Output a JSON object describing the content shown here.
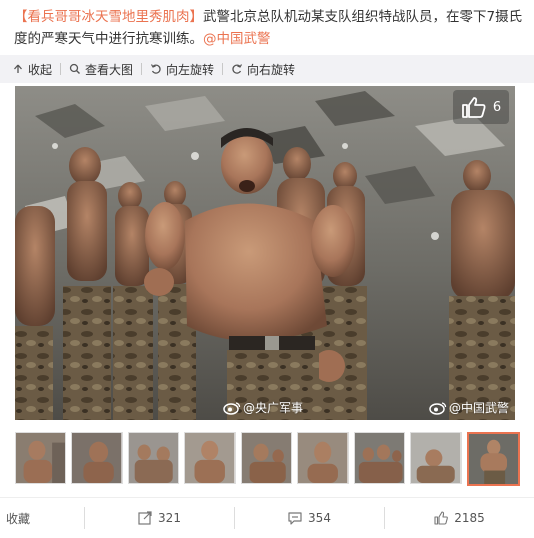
{
  "post": {
    "tag": "【看兵哥哥冰天雪地里秀肌肉】",
    "body": "武警北京总队机动某支队组织特战队员，在零下7摄氏度的严寒天气中进行抗寒训练。",
    "mention": "@中国武警"
  },
  "toolbar": {
    "collapse": "收起",
    "view_large": "查看大图",
    "rotate_left": "向左旋转",
    "rotate_right": "向右旋转",
    "icons": [
      "collapse-arrow-icon",
      "magnifier-icon",
      "rotate-left-icon",
      "rotate-right-icon"
    ]
  },
  "photo": {
    "like_count": "6",
    "watermark_left": "@央广军事",
    "watermark_right": "@中国武警"
  },
  "thumbnails": {
    "count": 9,
    "active_index": 8
  },
  "actions": {
    "favorite": "收藏",
    "repost": "321",
    "comment": "354",
    "like": "2185"
  },
  "colors": {
    "accent": "#eb7350",
    "toolbar_bg": "#f2f2f5",
    "text": "#333333"
  }
}
